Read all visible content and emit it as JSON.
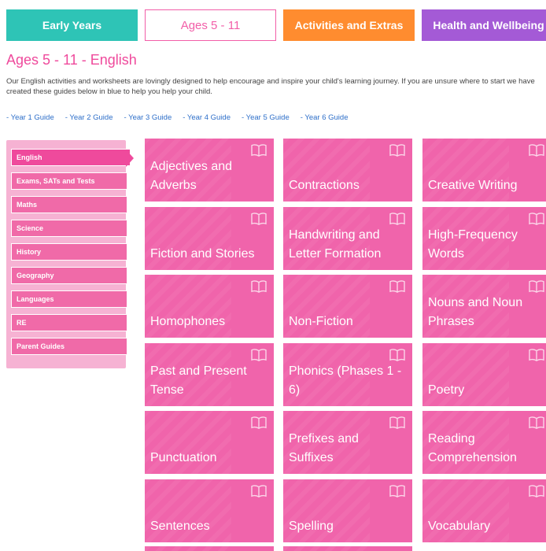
{
  "tabs": [
    {
      "label": "Early Years"
    },
    {
      "label": "Ages 5 - 11"
    },
    {
      "label": "Activities and Extras"
    },
    {
      "label": "Health and Wellbeing"
    }
  ],
  "page": {
    "title": "Ages 5 - 11 - English",
    "intro": "Our English activities and worksheets are lovingly designed to help encourage and inspire your child's learning journey. If you are unsure where to start we have created these guides below in blue to help you help your child."
  },
  "guides": [
    "- Year 1 Guide",
    "- Year 2 Guide",
    "- Year 3 Guide",
    "- Year 4 Guide",
    "- Year 5 Guide",
    "- Year 6 Guide"
  ],
  "sidebar": {
    "items": [
      {
        "label": "English"
      },
      {
        "label": "Exams, SATs and Tests"
      },
      {
        "label": "Maths"
      },
      {
        "label": "Science"
      },
      {
        "label": "History"
      },
      {
        "label": "Geography"
      },
      {
        "label": "Languages"
      },
      {
        "label": "RE"
      },
      {
        "label": "Parent Guides"
      }
    ]
  },
  "tiles": [
    {
      "label": "Adjectives and Adverbs"
    },
    {
      "label": "Contractions"
    },
    {
      "label": "Creative Writing"
    },
    {
      "label": "Fiction and Stories"
    },
    {
      "label": "Handwriting and Letter Formation"
    },
    {
      "label": "High-Frequency Words"
    },
    {
      "label": "Homophones"
    },
    {
      "label": "Non-Fiction"
    },
    {
      "label": "Nouns and Noun Phrases"
    },
    {
      "label": "Past and Present Tense"
    },
    {
      "label": "Phonics (Phases 1 - 6)"
    },
    {
      "label": "Poetry"
    },
    {
      "label": "Punctuation"
    },
    {
      "label": "Prefixes and Suffixes"
    },
    {
      "label": "Reading Comprehension"
    },
    {
      "label": "Sentences"
    },
    {
      "label": "Spelling"
    },
    {
      "label": "Vocabulary"
    }
  ],
  "colors": {
    "early_years": "#2ec4b6",
    "ages_5_11": "#f25ea8",
    "activities": "#ff8c2f",
    "health": "#a45ad6",
    "tile": "#f064ab",
    "sidebar_bg": "#f6b2d3",
    "guide_link": "#2e6fc9"
  }
}
